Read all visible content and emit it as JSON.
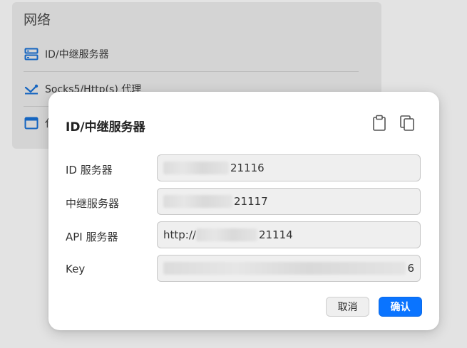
{
  "background": {
    "section_title": "网络",
    "items": [
      {
        "label": "ID/中继服务器",
        "icon": "server-icon"
      },
      {
        "label": "Socks5/Http(s) 代理",
        "icon": "proxy-icon"
      },
      {
        "label": "代",
        "icon": "window-icon"
      }
    ]
  },
  "dialog": {
    "title": "ID/中继服务器",
    "copy_tooltip_icon": "clipboard-icon",
    "paste_icon": "copy-icon",
    "fields": [
      {
        "label": "ID 服务器",
        "value_visible": "21116"
      },
      {
        "label": "中继服务器",
        "value_visible": "21117"
      },
      {
        "label": "API 服务器",
        "value_prefix": "http://",
        "value_visible": "21114"
      },
      {
        "label": "Key",
        "value_visible": "6"
      }
    ],
    "cancel_label": "取消",
    "ok_label": "确认"
  },
  "colors": {
    "accent": "#0a74ff",
    "icon_blue": "#1565c0"
  }
}
